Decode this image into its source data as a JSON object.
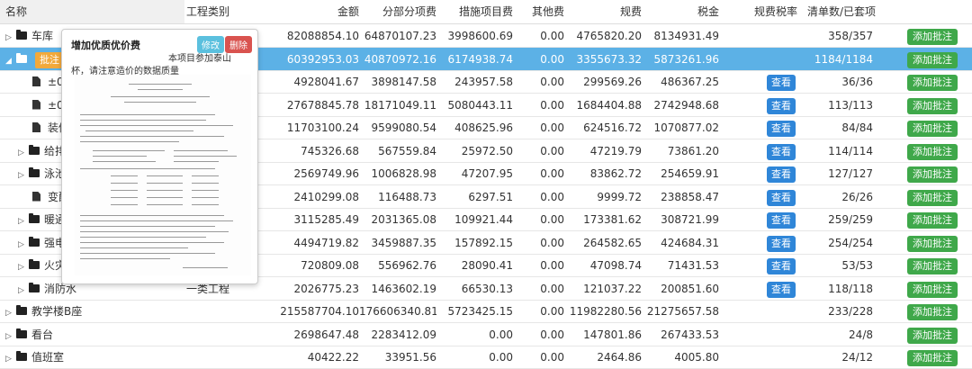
{
  "columns": {
    "name": "名称",
    "type": "工程类别",
    "amount": "金额",
    "sub_item": "分部分项费",
    "measure": "措施项目费",
    "other": "其他费",
    "fee": "规费",
    "tax": "税金",
    "fee_rate": "规费税率",
    "list_count": "清单数/已套项",
    "action": ""
  },
  "rows": [
    {
      "name": "车库",
      "type": "",
      "amount": "82088854.10",
      "sub_item": "64870107.23",
      "measure": "3998600.69",
      "other": "0.00",
      "fee": "4765820.20",
      "tax": "8134931.49",
      "rate_btn": "",
      "list_count": "358/357",
      "action": "添加批注",
      "kind": "folder"
    },
    {
      "name": "",
      "comment_tag": "批注",
      "type": "",
      "amount": "60392953.03",
      "sub_item": "40870972.16",
      "measure": "6174938.74",
      "other": "0.00",
      "fee": "3355673.32",
      "tax": "5873261.96",
      "rate_btn": "",
      "list_count": "1184/1184",
      "action": "添加批注",
      "kind": "folder-open"
    },
    {
      "name": "±0.0",
      "type": "",
      "amount": "4928041.67",
      "sub_item": "3898147.58",
      "measure": "243957.58",
      "other": "0.00",
      "fee": "299569.26",
      "tax": "486367.25",
      "rate_btn": "查看",
      "list_count": "36/36",
      "action": "添加批注",
      "kind": "file"
    },
    {
      "name": "±0.0",
      "type": "",
      "amount": "27678845.78",
      "sub_item": "18171049.11",
      "measure": "5080443.11",
      "other": "0.00",
      "fee": "1684404.88",
      "tax": "2742948.68",
      "rate_btn": "查看",
      "list_count": "113/113",
      "action": "添加批注",
      "kind": "file"
    },
    {
      "name": "装修",
      "type": "",
      "amount": "11703100.24",
      "sub_item": "9599080.54",
      "measure": "408625.96",
      "other": "0.00",
      "fee": "624516.72",
      "tax": "1070877.02",
      "rate_btn": "查看",
      "list_count": "84/84",
      "action": "添加批注",
      "kind": "file"
    },
    {
      "name": "给排",
      "type": "",
      "amount": "745326.68",
      "sub_item": "567559.84",
      "measure": "25972.50",
      "other": "0.00",
      "fee": "47219.79",
      "tax": "73861.20",
      "rate_btn": "查看",
      "list_count": "114/114",
      "action": "添加批注",
      "kind": "folder-sub"
    },
    {
      "name": "泳池",
      "type": "",
      "amount": "2569749.96",
      "sub_item": "1006828.98",
      "measure": "47207.95",
      "other": "0.00",
      "fee": "83862.72",
      "tax": "254659.91",
      "rate_btn": "查看",
      "list_count": "127/127",
      "action": "添加批注",
      "kind": "folder-sub"
    },
    {
      "name": "变配",
      "type": "",
      "amount": "2410299.08",
      "sub_item": "116488.73",
      "measure": "6297.51",
      "other": "0.00",
      "fee": "9999.72",
      "tax": "238858.47",
      "rate_btn": "查看",
      "list_count": "26/26",
      "action": "添加批注",
      "kind": "file"
    },
    {
      "name": "暖通",
      "type": "",
      "amount": "3115285.49",
      "sub_item": "2031365.08",
      "measure": "109921.44",
      "other": "0.00",
      "fee": "173381.62",
      "tax": "308721.99",
      "rate_btn": "查看",
      "list_count": "259/259",
      "action": "添加批注",
      "kind": "folder-sub"
    },
    {
      "name": "强电",
      "type": "",
      "amount": "4494719.82",
      "sub_item": "3459887.35",
      "measure": "157892.15",
      "other": "0.00",
      "fee": "264582.65",
      "tax": "424684.31",
      "rate_btn": "查看",
      "list_count": "254/254",
      "action": "添加批注",
      "kind": "folder-sub"
    },
    {
      "name": "火灾",
      "type": "",
      "amount": "720809.08",
      "sub_item": "556962.76",
      "measure": "28090.41",
      "other": "0.00",
      "fee": "47098.74",
      "tax": "71431.53",
      "rate_btn": "查看",
      "list_count": "53/53",
      "action": "添加批注",
      "kind": "folder-sub"
    },
    {
      "name": "消防水",
      "type": "一类工程",
      "amount": "2026775.23",
      "sub_item": "1463602.19",
      "measure": "66530.13",
      "other": "0.00",
      "fee": "121037.22",
      "tax": "200851.60",
      "rate_btn": "查看",
      "list_count": "118/118",
      "action": "添加批注",
      "kind": "folder-sub"
    },
    {
      "name": "教学楼B座",
      "type": "",
      "amount": "215587704.10",
      "sub_item": "176606340.81",
      "measure": "5723425.15",
      "other": "0.00",
      "fee": "11982280.56",
      "tax": "21275657.58",
      "rate_btn": "",
      "list_count": "233/228",
      "action": "添加批注",
      "kind": "folder"
    },
    {
      "name": "看台",
      "type": "",
      "amount": "2698647.48",
      "sub_item": "2283412.09",
      "measure": "0.00",
      "other": "0.00",
      "fee": "147801.86",
      "tax": "267433.53",
      "rate_btn": "",
      "list_count": "24/8",
      "action": "添加批注",
      "kind": "folder"
    },
    {
      "name": "值班室",
      "type": "",
      "amount": "40422.22",
      "sub_item": "33951.56",
      "measure": "0.00",
      "other": "0.00",
      "fee": "2464.86",
      "tax": "4005.80",
      "rate_btn": "",
      "list_count": "24/12",
      "action": "添加批注",
      "kind": "folder"
    }
  ],
  "popover": {
    "title": "增加优质优价费",
    "edit_label": "修改",
    "delete_label": "删除",
    "text_line1": "本项目参加泰山",
    "text_line2": "杯，请注意造价的数据质量"
  },
  "colors": {
    "selected_row": "#5cb1e6",
    "add_button": "#3fa84a",
    "view_button": "#2f86d8",
    "comment_tag": "#f2a93b",
    "edit_button": "#5bc0de",
    "delete_button": "#d9534f"
  }
}
